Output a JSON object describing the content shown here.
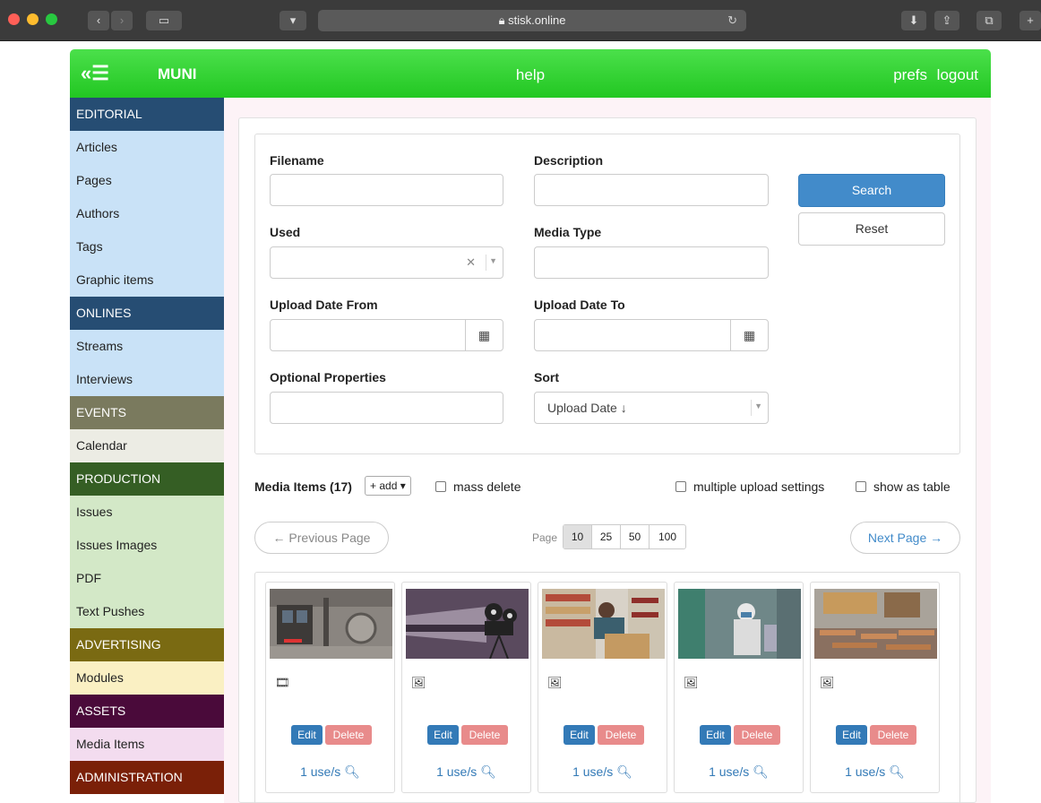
{
  "browser": {
    "url": "stisk.online"
  },
  "header": {
    "menu_glyph": "«☰",
    "logo": "MUNI",
    "help": "help",
    "prefs": "prefs",
    "logout": "logout",
    "color": "#2ecc2e"
  },
  "sidebar": {
    "sections": [
      {
        "title": "EDITORIAL",
        "head_color": "#264d73",
        "item_color": "#c9e2f7",
        "items": [
          "Articles",
          "Pages",
          "Authors",
          "Tags",
          "Graphic items"
        ]
      },
      {
        "title": "ONLINES",
        "head_color": "#264d73",
        "item_color": "#c9e2f7",
        "items": [
          "Streams",
          "Interviews"
        ]
      },
      {
        "title": "EVENTS",
        "head_color": "#7a7a5e",
        "item_color": "#ececE4",
        "items": [
          "Calendar"
        ]
      },
      {
        "title": "PRODUCTION",
        "head_color": "#355e24",
        "item_color": "#d3e8c7",
        "items": [
          "Issues",
          "Issues Images",
          "PDF",
          "Text Pushes"
        ]
      },
      {
        "title": "ADVERTISING",
        "head_color": "#7a6a12",
        "item_color": "#faf0c3",
        "items": [
          "Modules"
        ]
      },
      {
        "title": "ASSETS",
        "head_color": "#4a0a3a",
        "item_color": "#f3dcef",
        "items": [
          "Media Items"
        ]
      },
      {
        "title": "ADMINISTRATION",
        "head_color": "#7a2008",
        "item_color": "#f5d6c8",
        "items": []
      }
    ],
    "active_item": "Media Items"
  },
  "filters": {
    "filename_label": "Filename",
    "filename_value": "",
    "description_label": "Description",
    "description_value": "",
    "used_label": "Used",
    "used_value": "",
    "media_type_label": "Media Type",
    "media_type_value": "",
    "date_from_label": "Upload Date From",
    "date_from_value": "",
    "date_to_label": "Upload Date To",
    "date_to_value": "",
    "optional_label": "Optional Properties",
    "optional_value": "",
    "sort_label": "Sort",
    "sort_value": "Upload Date ↓",
    "search_button": "Search",
    "reset_button": "Reset"
  },
  "toolbar": {
    "title": "Media Items (17)",
    "add_label": "+ add ▾",
    "mass_delete": "mass delete",
    "multiple_upload": "multiple upload settings",
    "show_as_table": "show as table"
  },
  "pager": {
    "prev": "← Previous Page",
    "next": "Next Page →",
    "page_label": "Page",
    "sizes": [
      "10",
      "25",
      "50",
      "100"
    ],
    "active_size": "10"
  },
  "media_items": [
    {
      "type_icon": "film-icon",
      "edit": "Edit",
      "delete": "Delete",
      "uses": "1 use/s"
    },
    {
      "type_icon": "image-icon",
      "edit": "Edit",
      "delete": "Delete",
      "uses": "1 use/s"
    },
    {
      "type_icon": "image-icon",
      "edit": "Edit",
      "delete": "Delete",
      "uses": "1 use/s"
    },
    {
      "type_icon": "image-icon",
      "edit": "Edit",
      "delete": "Delete",
      "uses": "1 use/s"
    },
    {
      "type_icon": "image-icon",
      "edit": "Edit",
      "delete": "Delete",
      "uses": "1 use/s"
    }
  ]
}
